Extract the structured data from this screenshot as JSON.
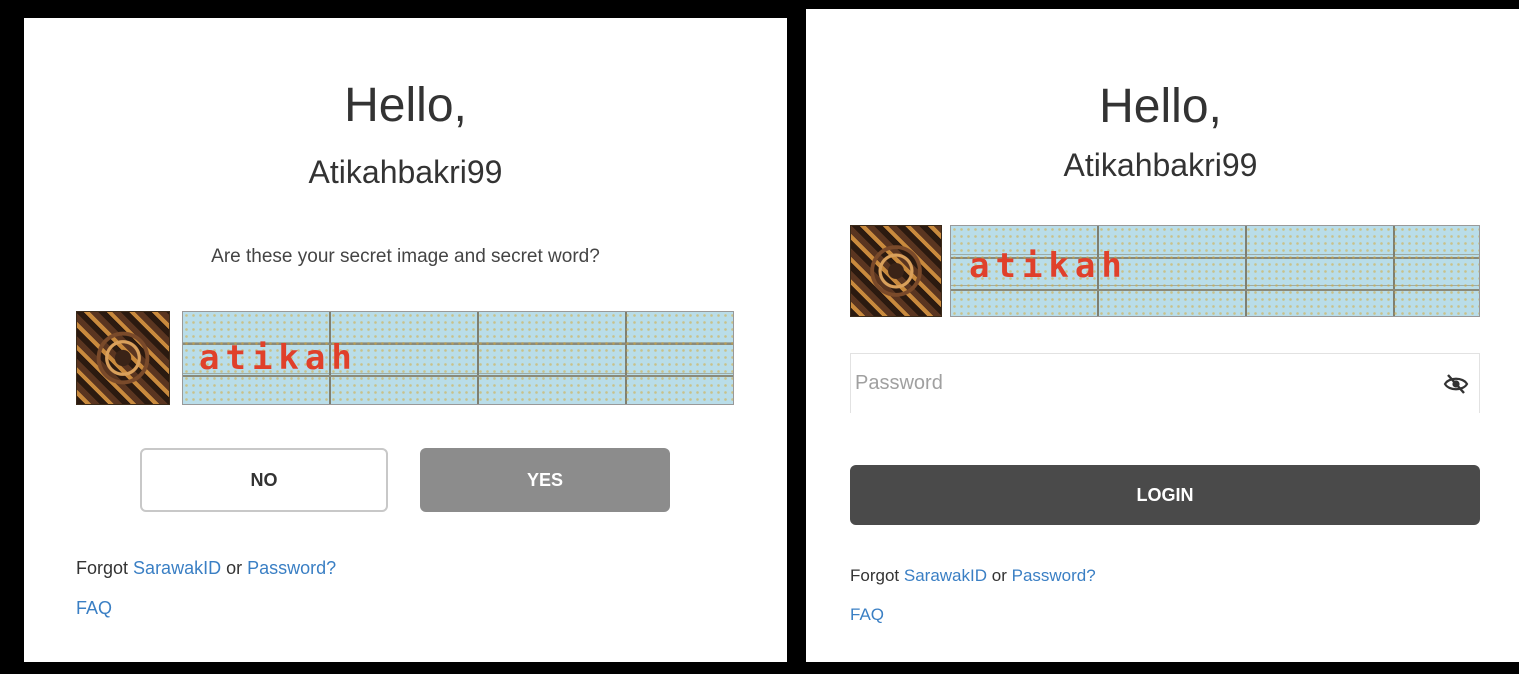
{
  "left": {
    "greeting": "Hello,",
    "username": "Atikahbakri99",
    "question": "Are these your secret image and secret word?",
    "secret_word": "atikah",
    "no_label": "NO",
    "yes_label": "YES",
    "forgot_prefix": "Forgot",
    "forgot_id_link": "SarawakID",
    "forgot_or": "or",
    "forgot_pw_link": "Password?",
    "faq": "FAQ"
  },
  "right": {
    "greeting": "Hello,",
    "username": "Atikahbakri99",
    "secret_word": "atikah",
    "password_placeholder": "Password",
    "login_label": "LOGIN",
    "forgot_prefix": "Forgot",
    "forgot_id_link": "SarawakID",
    "forgot_or": "or",
    "forgot_pw_link": "Password?",
    "faq": "FAQ"
  },
  "icons": {
    "secret_image": "tribal-pattern-image",
    "password_toggle": "eye-slash-icon"
  },
  "colors": {
    "link": "#3a7fc4",
    "yes_button": "#8c8c8c",
    "login_button": "#4a4a4a",
    "secret_word_text": "#e0402a",
    "secret_word_bg": "#b9dde9"
  }
}
